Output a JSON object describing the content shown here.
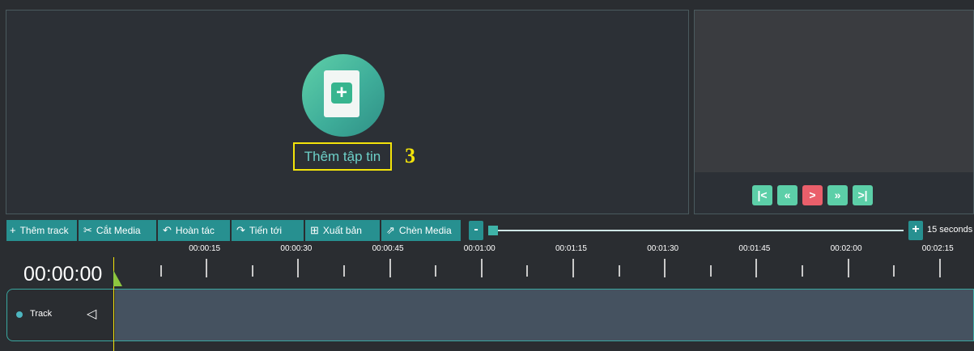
{
  "media_panel": {
    "add_file_label": "Thêm tập tin",
    "step_number": "3"
  },
  "preview": {
    "buttons": [
      "skip-to-start",
      "rewind",
      "play",
      "fast-forward",
      "skip-to-end"
    ]
  },
  "toolbar": {
    "add_track": "Thêm track",
    "cut_media": "Cắt Media",
    "undo": "Hoàn tác",
    "redo": "Tiến tới",
    "export": "Xuất bản",
    "insert_media": "Chèn Media"
  },
  "zoom": {
    "minus": "-",
    "plus": "+",
    "scale_label": "15 seconds",
    "level": 0.0
  },
  "ruler": {
    "labels": [
      "00:00:15",
      "00:00:30",
      "00:00:45",
      "00:01:00",
      "00:01:15",
      "00:01:30",
      "00:01:45",
      "00:02:00",
      "00:02:15"
    ]
  },
  "timeline": {
    "timecode": "00:00:00"
  },
  "track": {
    "name": "Track"
  },
  "colors": {
    "accent": "#279090",
    "highlight": "#f3e30a",
    "play": "#ea5f6b",
    "player_buttons": "#5ccfa8"
  }
}
